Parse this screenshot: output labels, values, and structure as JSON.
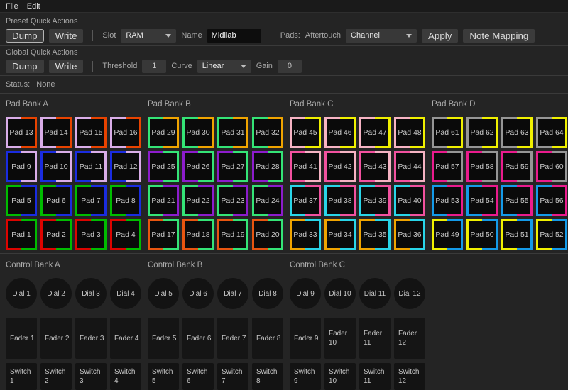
{
  "menu": {
    "items": [
      "File",
      "Edit"
    ]
  },
  "preset": {
    "title": "Preset Quick Actions",
    "dump_label": "Dump",
    "write_label": "Write",
    "slot_label": "Slot",
    "slot_value": "RAM",
    "name_label": "Name",
    "name_value": "Midilab",
    "pads_label": "Pads:",
    "aftertouch_label": "Aftertouch",
    "aftertouch_value": "Channel",
    "apply_label": "Apply",
    "note_mapping_label": "Note Mapping"
  },
  "global": {
    "title": "Global Quick Actions",
    "dump_label": "Dump",
    "write_label": "Write",
    "threshold_label": "Threshold",
    "threshold_value": "1",
    "curve_label": "Curve",
    "curve_value": "Linear",
    "gain_label": "Gain",
    "gain_value": "0"
  },
  "status": {
    "label": "Status:",
    "value": "None"
  },
  "pad_banks": [
    {
      "title": "Pad Bank A",
      "rows": [
        {
          "left_color": "#d9ade8",
          "right_color": "#e84300",
          "pads": [
            "Pad 13",
            "Pad 14",
            "Pad 15",
            "Pad 16"
          ]
        },
        {
          "left_color": "#1a2ce0",
          "right_color": "#d9ade8",
          "pads": [
            "Pad 9",
            "Pad 10",
            "Pad 11",
            "Pad 12"
          ]
        },
        {
          "left_color": "#00bc00",
          "right_color": "#1a2ce0",
          "pads": [
            "Pad 5",
            "Pad 6",
            "Pad 7",
            "Pad 8"
          ]
        },
        {
          "left_color": "#dc0400",
          "right_color": "#00bc00",
          "pads": [
            "Pad 1",
            "Pad 2",
            "Pad 3",
            "Pad 4"
          ]
        }
      ]
    },
    {
      "title": "Pad Bank B",
      "rows": [
        {
          "left_color": "#34e476",
          "right_color": "#f0a400",
          "pads": [
            "Pad 29",
            "Pad 30",
            "Pad 31",
            "Pad 32"
          ]
        },
        {
          "left_color": "#8c1ccc",
          "right_color": "#34e476",
          "pads": [
            "Pad 25",
            "Pad 26",
            "Pad 27",
            "Pad 28"
          ]
        },
        {
          "left_color": "#34e476",
          "right_color": "#8c1ccc",
          "pads": [
            "Pad 21",
            "Pad 22",
            "Pad 23",
            "Pad 24"
          ]
        },
        {
          "left_color": "#e85510",
          "right_color": "#34e476",
          "pads": [
            "Pad 17",
            "Pad 18",
            "Pad 19",
            "Pad 20"
          ]
        }
      ]
    },
    {
      "title": "Pad Bank C",
      "rows": [
        {
          "left_color": "#f6b3c3",
          "right_color": "#f0f000",
          "pads": [
            "Pad 45",
            "Pad 46",
            "Pad 47",
            "Pad 48"
          ]
        },
        {
          "left_color": "#f2519f",
          "right_color": "#f6b3c3",
          "pads": [
            "Pad 41",
            "Pad 42",
            "Pad 43",
            "Pad 44"
          ]
        },
        {
          "left_color": "#29d5e8",
          "right_color": "#f2519f",
          "pads": [
            "Pad 37",
            "Pad 38",
            "Pad 39",
            "Pad 40"
          ]
        },
        {
          "left_color": "#f0a400",
          "right_color": "#29d5e8",
          "pads": [
            "Pad 33",
            "Pad 34",
            "Pad 35",
            "Pad 36"
          ]
        }
      ]
    },
    {
      "title": "Pad Bank D",
      "rows": [
        {
          "left_color": "#969696",
          "right_color": "#f0f000",
          "pads": [
            "Pad 61",
            "Pad 62",
            "Pad 63",
            "Pad 64"
          ]
        },
        {
          "left_color": "#ea1b8d",
          "right_color": "#969696",
          "pads": [
            "Pad 57",
            "Pad 58",
            "Pad 59",
            "Pad 60"
          ]
        },
        {
          "left_color": "#149ae8",
          "right_color": "#ea1b8d",
          "pads": [
            "Pad 53",
            "Pad 54",
            "Pad 55",
            "Pad 56"
          ]
        },
        {
          "left_color": "#f0f000",
          "right_color": "#149ae8",
          "pads": [
            "Pad 49",
            "Pad 50",
            "Pad 51",
            "Pad 52"
          ]
        }
      ]
    }
  ],
  "control_banks": [
    {
      "title": "Control Bank A",
      "dials": [
        "Dial 1",
        "Dial 2",
        "Dial 3",
        "Dial 4"
      ],
      "faders": [
        "Fader 1",
        "Fader 2",
        "Fader 3",
        "Fader 4"
      ],
      "switches": [
        "Switch\n1",
        "Switch\n2",
        "Switch\n3",
        "Switch\n4"
      ]
    },
    {
      "title": "Control Bank B",
      "dials": [
        "Dial 5",
        "Dial 6",
        "Dial 7",
        "Dial 8"
      ],
      "faders": [
        "Fader 5",
        "Fader 6",
        "Fader 7",
        "Fader 8"
      ],
      "switches": [
        "Switch\n5",
        "Switch\n6",
        "Switch\n7",
        "Switch\n8"
      ]
    },
    {
      "title": "Control Bank C",
      "dials": [
        "Dial 9",
        "Dial 10",
        "Dial 11",
        "Dial 12"
      ],
      "faders": [
        "Fader 9",
        "Fader\n10",
        "Fader\n11",
        "Fader\n12"
      ],
      "switches": [
        "Switch\n9",
        "Switch\n10",
        "Switch\n11",
        "Switch\n12"
      ]
    }
  ],
  "colors": {
    "background": "#242424",
    "panel_dark": "#0a0a0a",
    "control_dark": "#131313",
    "button_bg": "#3b3b3b",
    "separator": "#3a3a3a"
  }
}
